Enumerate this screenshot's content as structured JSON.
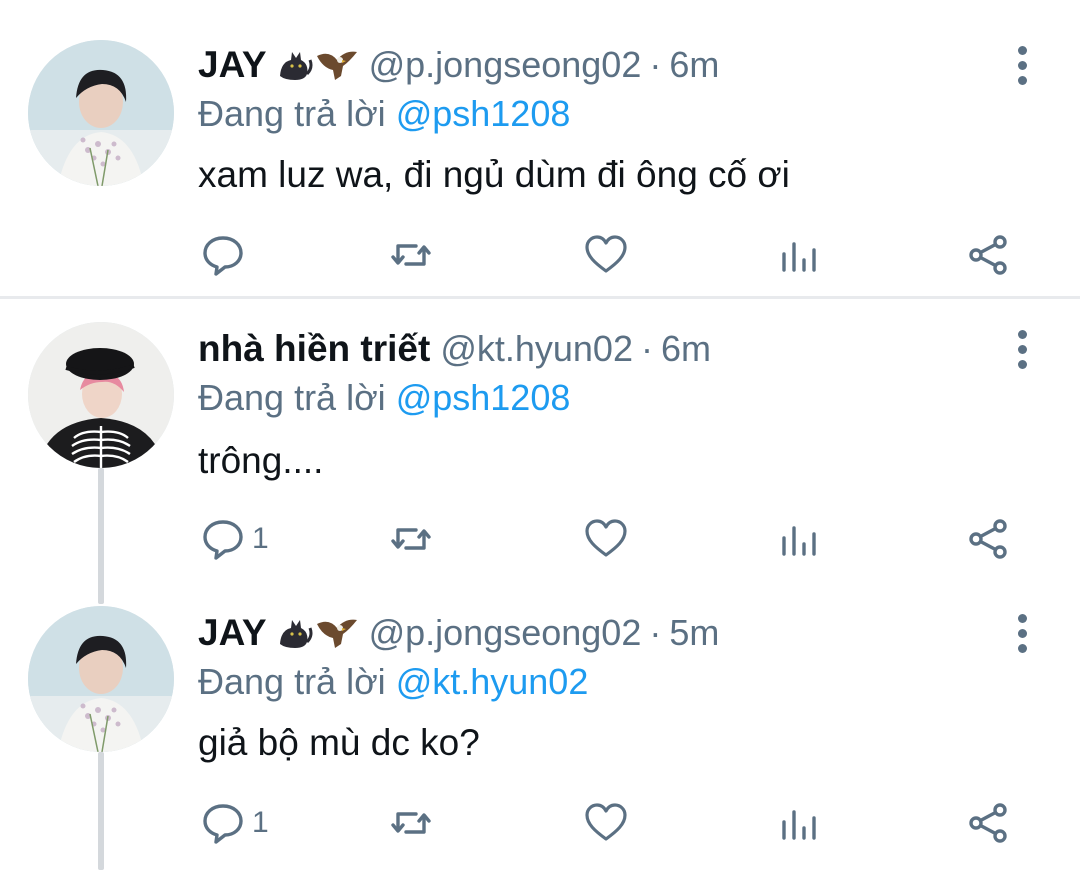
{
  "tweets": [
    {
      "author": "JAY",
      "handle": "@p.jongseong02",
      "separator": "·",
      "time": "6m",
      "reply_prefix": "Đang trả lời",
      "reply_to": "@psh1208",
      "text": "xam luz wa, đi ngủ dùm đi ông cố ơi",
      "reply_count": "",
      "emojis": [
        "black-cat-icon",
        "eagle-icon"
      ]
    },
    {
      "author": "nhà hiền triết",
      "handle": "@kt.hyun02",
      "separator": "·",
      "time": "6m",
      "reply_prefix": "Đang trả lời",
      "reply_to": "@psh1208",
      "text": "trông....",
      "reply_count": "1",
      "emojis": []
    },
    {
      "author": "JAY",
      "handle": "@p.jongseong02",
      "separator": "·",
      "time": "5m",
      "reply_prefix": "Đang trả lời",
      "reply_to": "@kt.hyun02",
      "text": "giả bộ mù dc ko?",
      "reply_count": "1",
      "emojis": [
        "black-cat-icon",
        "eagle-icon"
      ]
    }
  ],
  "colors": {
    "text": "#0f1419",
    "secondary": "#5b7083",
    "link": "#1d9bf0",
    "divider": "#e8eaed",
    "thread_line": "#d4d8dc"
  },
  "action_icons": [
    "reply-icon",
    "retweet-icon",
    "like-icon",
    "analytics-icon",
    "share-icon"
  ]
}
